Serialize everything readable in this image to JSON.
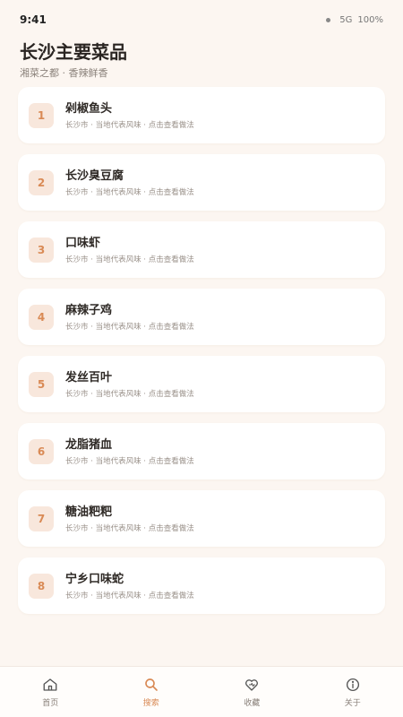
{
  "status_bar": {
    "time": "9:41",
    "network": "5G",
    "battery": "100%"
  },
  "header": {
    "title": "长沙主要菜品",
    "subtitle": "湘菜之都 · 香辣鲜香"
  },
  "dishes": [
    {
      "num": "1",
      "name": "剁椒鱼头",
      "desc": "长沙市 · 当地代表风味 · 点击查看做法"
    },
    {
      "num": "2",
      "name": "长沙臭豆腐",
      "desc": "长沙市 · 当地代表风味 · 点击查看做法"
    },
    {
      "num": "3",
      "name": "口味虾",
      "desc": "长沙市 · 当地代表风味 · 点击查看做法"
    },
    {
      "num": "4",
      "name": "麻辣子鸡",
      "desc": "长沙市 · 当地代表风味 · 点击查看做法"
    },
    {
      "num": "5",
      "name": "发丝百叶",
      "desc": "长沙市 · 当地代表风味 · 点击查看做法"
    },
    {
      "num": "6",
      "name": "龙脂猪血",
      "desc": "长沙市 · 当地代表风味 · 点击查看做法"
    },
    {
      "num": "7",
      "name": "糖油粑粑",
      "desc": "长沙市 · 当地代表风味 · 点击查看做法"
    },
    {
      "num": "8",
      "name": "宁乡口味蛇",
      "desc": "长沙市 · 当地代表风味 · 点击查看做法"
    }
  ],
  "tabbar": {
    "items": [
      {
        "label": "首页",
        "icon": "home-icon"
      },
      {
        "label": "搜索",
        "icon": "search-icon"
      },
      {
        "label": "收藏",
        "icon": "heart-icon"
      },
      {
        "label": "关于",
        "icon": "info-icon"
      }
    ],
    "active": "搜索"
  },
  "colors": {
    "accent": "#d98a55",
    "badge_bg": "#f8e7dc",
    "page_bg": "#fcf6f1"
  }
}
